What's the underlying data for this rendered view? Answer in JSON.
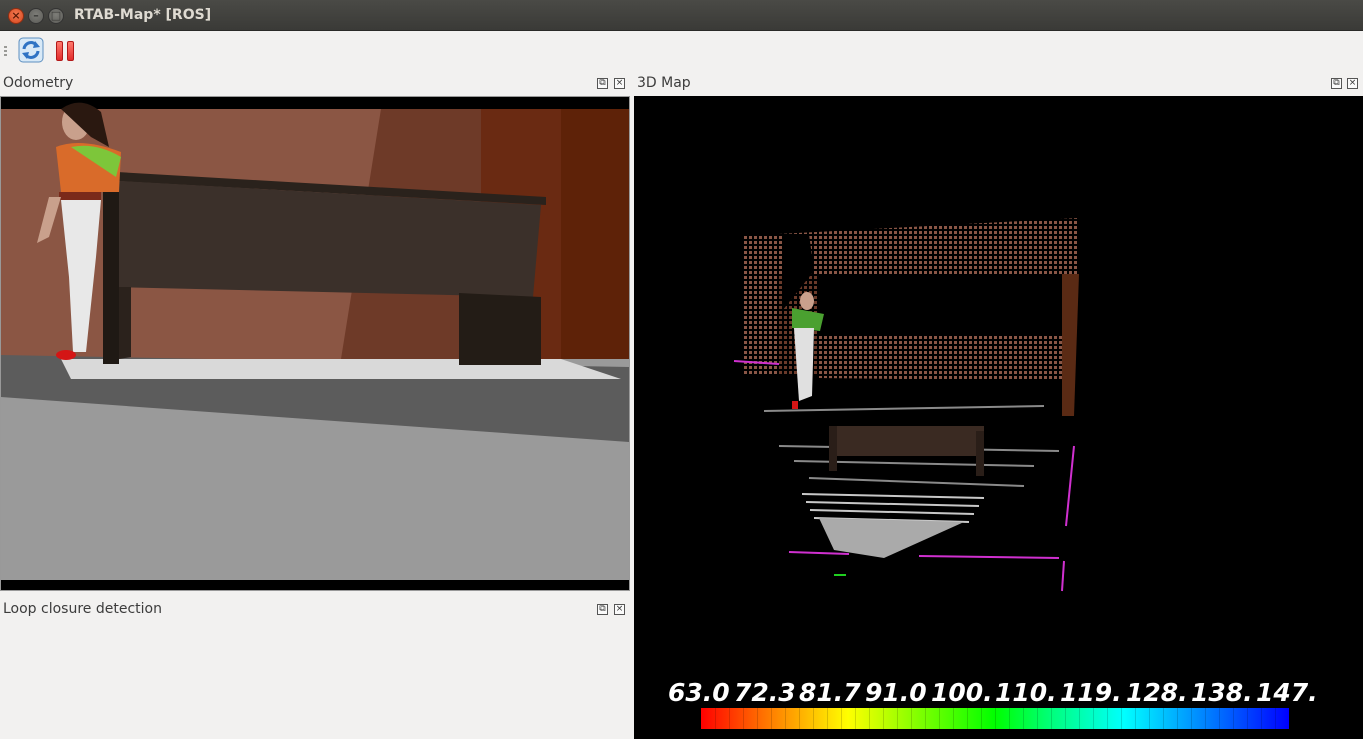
{
  "window": {
    "title": "RTAB-Map* [ROS]"
  },
  "docks": {
    "odometry": {
      "title": "Odometry"
    },
    "map3d": {
      "title": "3D Map"
    },
    "loop_closure": {
      "title": "Loop closure detection"
    },
    "float_glyph": "⧉",
    "close_glyph": "×"
  },
  "titlebar_buttons": {
    "close": "×",
    "minimize": "–",
    "maximize": "□"
  },
  "legend": {
    "ticks": [
      "63.0",
      "72.3",
      "81.7",
      "91.0",
      "100.",
      "110.",
      "119.",
      "128.",
      "138.",
      "147."
    ]
  },
  "icons": {
    "refresh": "refresh-icon",
    "pause": "pause-icon"
  },
  "colors": {
    "titlebar": "#3c3c39",
    "close_button": "#e9541d",
    "pause_red": "#e22c2c",
    "wall": "#8a5040",
    "floor": "#9a9a9a"
  }
}
